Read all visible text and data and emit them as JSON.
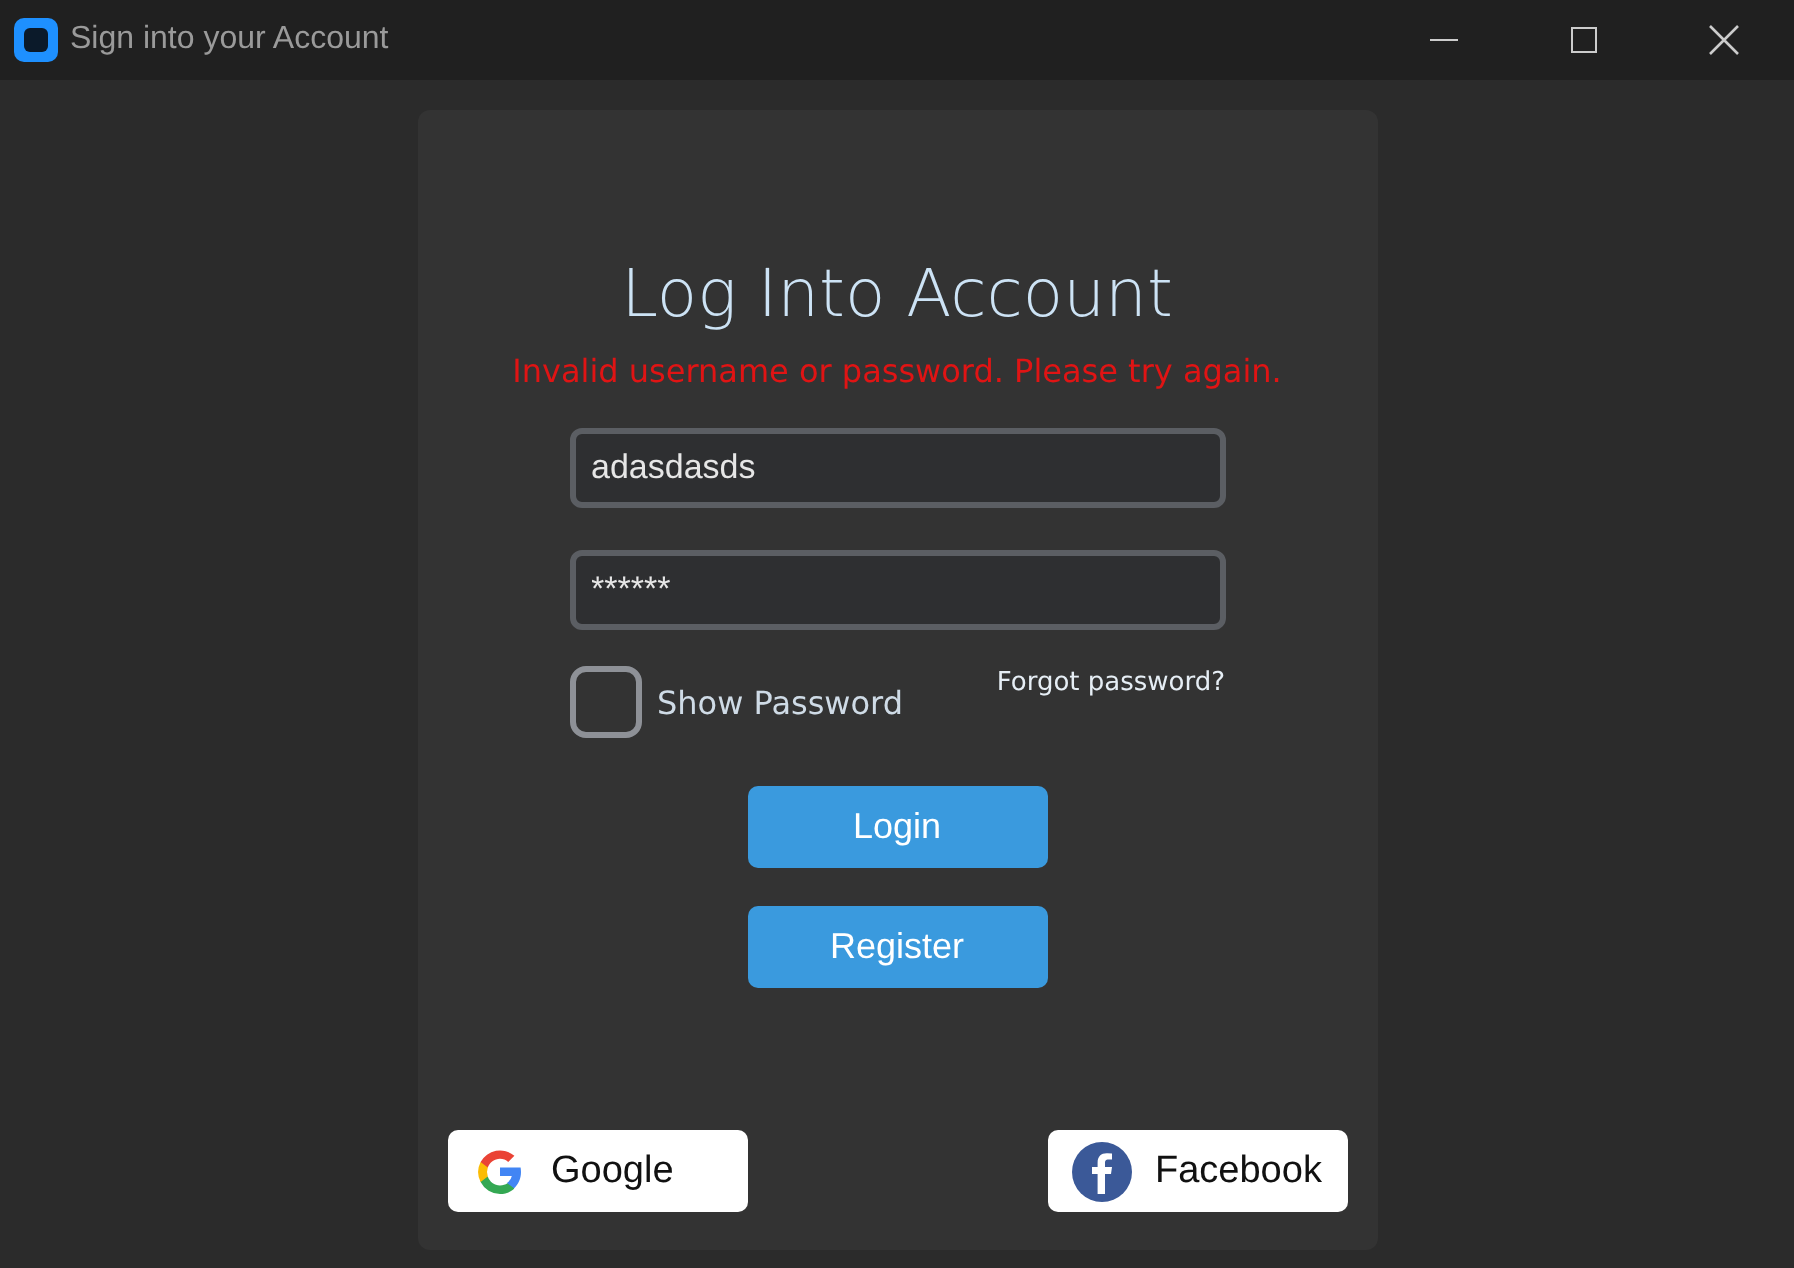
{
  "window": {
    "title": "Sign into your Account"
  },
  "heading": "Log Into Account",
  "error": "Invalid username or password. Please try again.",
  "username": {
    "value": "adasdasds"
  },
  "password": {
    "value": "******"
  },
  "show_password": {
    "label": "Show Password",
    "checked": false
  },
  "forgot_link": "Forgot password?",
  "buttons": [
    {
      "label": "Login"
    },
    {
      "label": "Register"
    }
  ],
  "social": [
    {
      "kind": "google",
      "label": "Google"
    },
    {
      "kind": "facebook",
      "label": "Facebook"
    }
  ]
}
